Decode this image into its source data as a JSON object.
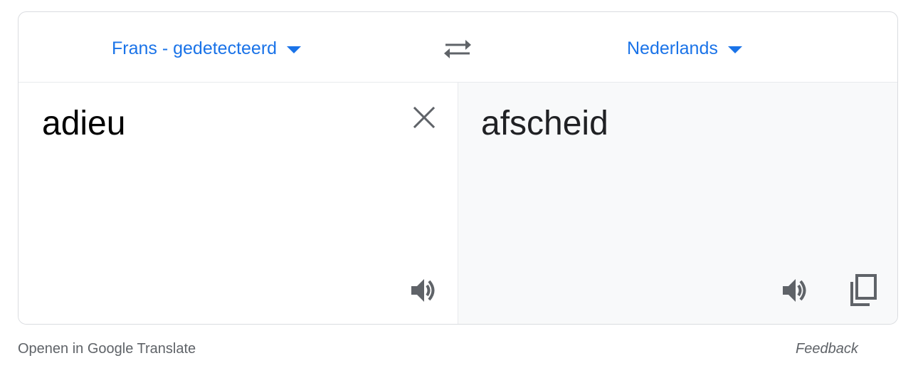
{
  "header": {
    "source_language": "Frans - gedetecteerd",
    "target_language": "Nederlands"
  },
  "source": {
    "text": "adieu"
  },
  "target": {
    "text": "afscheid"
  },
  "footer": {
    "open_link": "Openen in Google Translate",
    "feedback": "Feedback"
  },
  "colors": {
    "accent": "#1a73e8",
    "icon": "#5f6368",
    "result_background": "#f8f9fa",
    "border": "#dadce0"
  },
  "icons": {
    "swap": "swap-arrows-icon",
    "clear": "close-icon",
    "listen": "speaker-icon",
    "copy": "copy-icon",
    "caret": "caret-down-icon"
  }
}
